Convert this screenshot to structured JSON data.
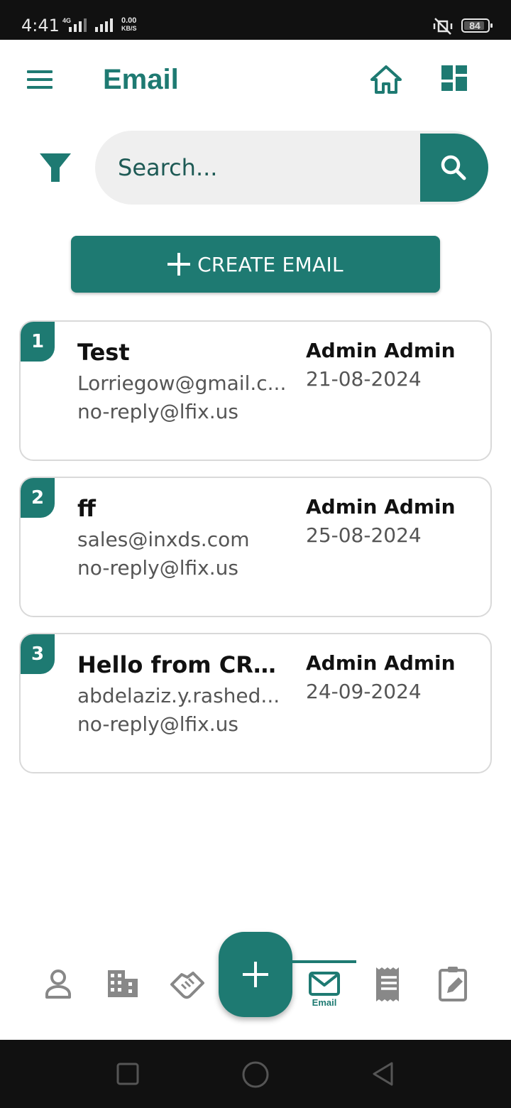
{
  "status_bar": {
    "time": "4:41",
    "network": "4G",
    "speed_value": "0.00",
    "speed_unit": "KB/S",
    "battery": "84"
  },
  "header": {
    "title": "Email",
    "icons": [
      "menu-icon",
      "home-icon",
      "dashboard-icon"
    ]
  },
  "search": {
    "placeholder": "Search...",
    "filter_icon": "filter-icon",
    "search_icon": "search-icon"
  },
  "create_button": {
    "label": "CREATE EMAIL",
    "icon": "plus-icon"
  },
  "emails": [
    {
      "index": "1",
      "subject": "Test",
      "to": "Lorriegow@gmail.c...",
      "from": "no-reply@lfix.us",
      "owner": "Admin Admin",
      "date": "21-08-2024"
    },
    {
      "index": "2",
      "subject": "ff",
      "to": "sales@inxds.com",
      "from": "no-reply@lfix.us",
      "owner": "Admin Admin",
      "date": "25-08-2024"
    },
    {
      "index": "3",
      "subject": "Hello from CRM ...",
      "to": "abdelaziz.y.rashed...",
      "from": "no-reply@lfix.us",
      "owner": "Admin Admin",
      "date": "24-09-2024"
    }
  ],
  "bottom_nav": {
    "items": [
      "contacts-icon",
      "company-icon",
      "deals-icon",
      "add-icon",
      "email-icon",
      "invoice-icon",
      "tasks-icon"
    ],
    "active_label": "Email"
  },
  "colors": {
    "primary": "#1e7a72",
    "status_bar": "#111111",
    "search_bg": "#efefef"
  }
}
